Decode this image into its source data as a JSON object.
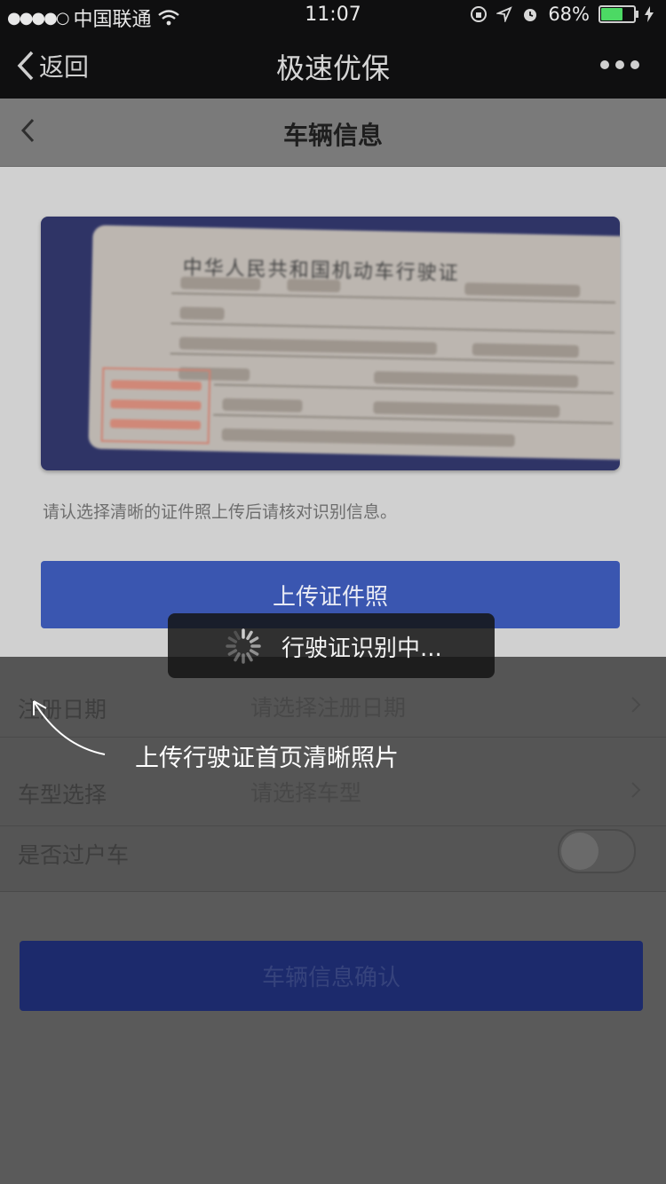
{
  "status_bar": {
    "carrier": "中国联通",
    "time": "11:07",
    "battery": "68%",
    "battery_level": 0.68
  },
  "nav": {
    "back_label": "返回",
    "title": "极速优保"
  },
  "page": {
    "title": "车辆信息"
  },
  "card": {
    "title": "中华人民共和国机动车行驶证"
  },
  "hint": "请认选择清晰的证件照上传后请核对识别信息。",
  "upload_button": "上传证件照",
  "form": {
    "rows": [
      {
        "label": "注册日期",
        "value": "请选择注册日期"
      },
      {
        "label": "车型选择",
        "value": "请选择车型"
      },
      {
        "label": "是否过户车",
        "toggle": false
      }
    ]
  },
  "confirm_button": "车辆信息确认",
  "toast": "行驶证识别中...",
  "guide": "上传行驶证首页清晰照片",
  "colors": {
    "primary": "#3a56b0",
    "overlay": "#555555"
  }
}
